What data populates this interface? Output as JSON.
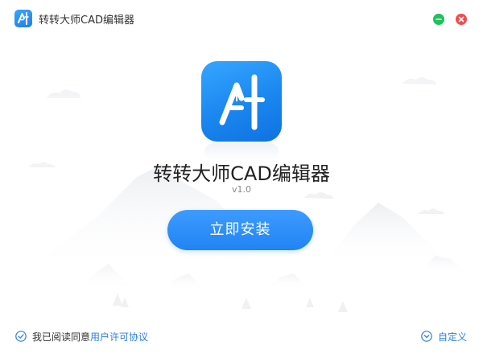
{
  "window": {
    "title": "转转大师CAD编辑器",
    "minimize_icon": "minimize-icon",
    "close_icon": "close-icon"
  },
  "main": {
    "app_name": "转转大师CAD编辑器",
    "version": "v1.0",
    "install_label": "立即安装",
    "logo_icon": "app-logo-a-pen-icon"
  },
  "footer": {
    "agree_prefix": "我已阅读同意",
    "agree_link": "用户许可协议",
    "agree_checked": true,
    "custom_label": "自定义"
  },
  "colors": {
    "accent": "#2184f3",
    "minimize": "#20c05c",
    "close": "#f24d4d",
    "link": "#2a7fe5"
  }
}
